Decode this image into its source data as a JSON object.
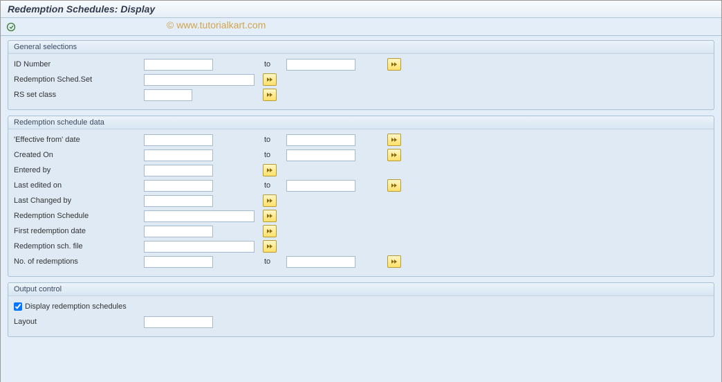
{
  "page_title": "Redemption Schedules: Display",
  "watermark": "© www.tutorialkart.com",
  "groups": {
    "general": {
      "title": "General selections",
      "id_number": "ID Number",
      "redemption_sched_set": "Redemption Sched.Set",
      "rs_set_class": "RS set class"
    },
    "schedule": {
      "title": "Redemption schedule data",
      "effective_from": "'Effective from' date",
      "created_on": "Created On",
      "entered_by": "Entered by",
      "last_edited_on": "Last edited on",
      "last_changed_by": "Last Changed by",
      "redemption_schedule": "Redemption Schedule",
      "first_redemption_date": "First redemption date",
      "redemption_sch_file": "Redemption sch. file",
      "no_of_redemptions": "No. of redemptions"
    },
    "output": {
      "title": "Output control",
      "display_schedules": "Display redemption schedules",
      "display_schedules_checked": true,
      "layout": "Layout"
    }
  },
  "to_label": "to"
}
